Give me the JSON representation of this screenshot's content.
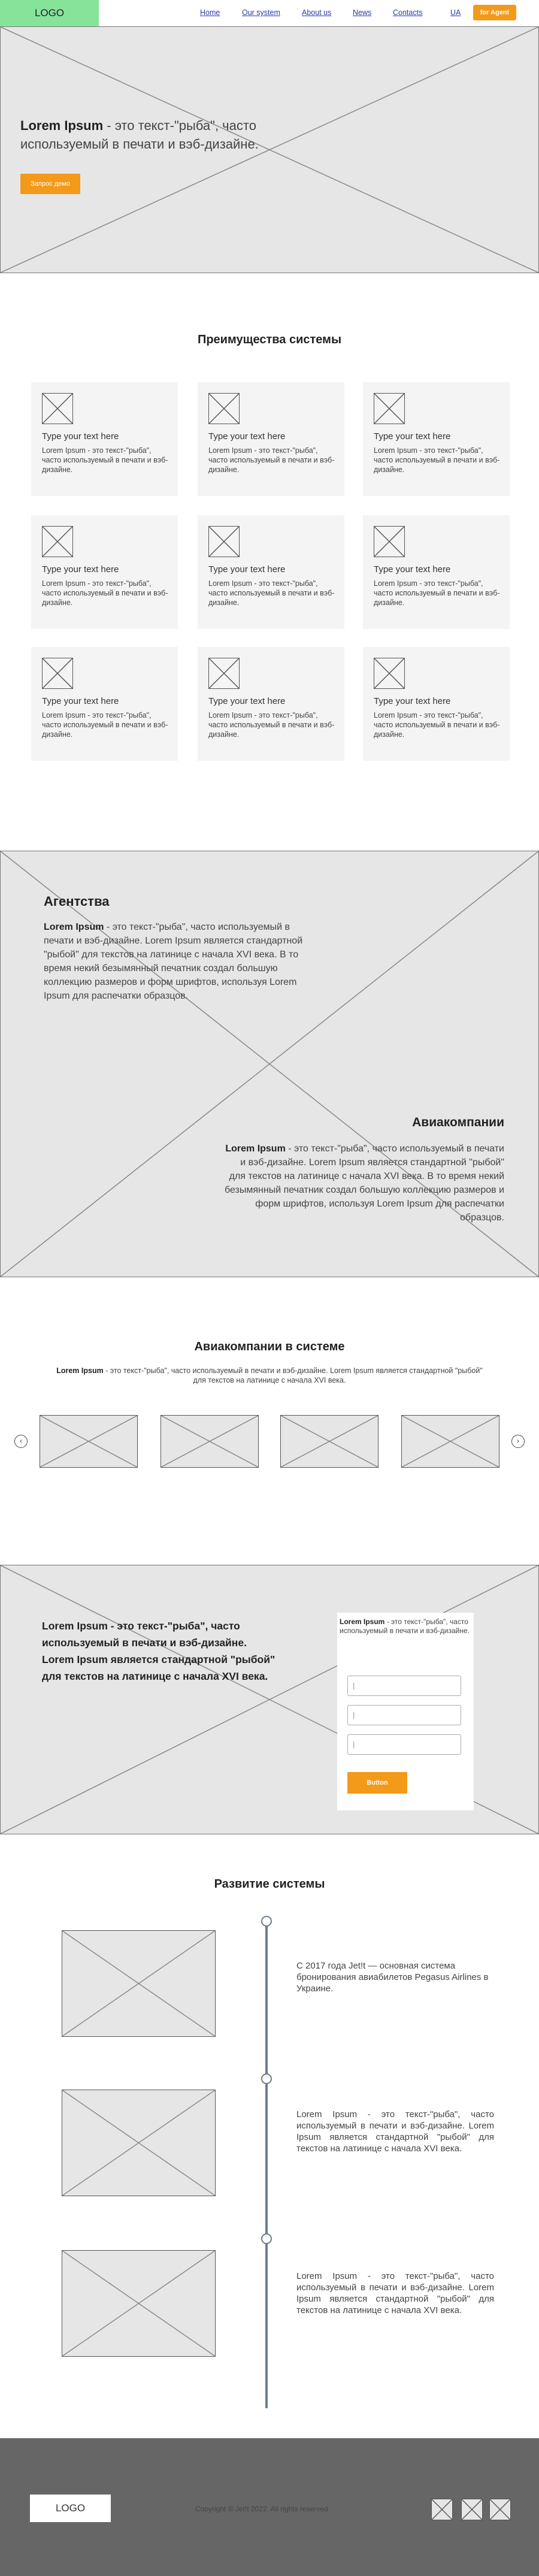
{
  "header": {
    "logo": "LOGO",
    "nav": [
      "Home",
      "Our system",
      "About us",
      "News",
      "Contacts"
    ],
    "lang": "UA",
    "cta": "for Agent"
  },
  "hero": {
    "lead_bold": "Lorem Ipsum",
    "lead_rest": " - это текст-\"рыба\", часто используемый в печати и вэб-дизайне.",
    "button": "Запрос демо"
  },
  "benefits": {
    "title": "Преимущества системы",
    "card_title": "Type your text here",
    "card_desc": "Lorem Ipsum - это текст-\"рыба\", часто используемый в печати и вэб-дизайне.",
    "count": 9
  },
  "agencies": {
    "title": "Агентства",
    "lead_bold": "Lorem Ipsum",
    "text": " - это текст-\"рыба\", часто используемый в печати и вэб-дизайне. Lorem Ipsum является стандартной \"рыбой\" для текстов на латинице с начала XVI века. В то время некий безымянный печатник создал большую коллекцию размеров и форм шрифтов, используя Lorem Ipsum для распечатки образцов."
  },
  "airlines_block": {
    "title": "Авиакомпании",
    "lead_bold": "Lorem Ipsum",
    "text": " - это текст-\"рыба\", часто используемый в печати и вэб-дизайне. Lorem Ipsum является стандартной \"рыбой\" для текстов на латинице с начала XVI века. В то время некий безымянный печатник создал большую коллекцию размеров и форм шрифтов, используя Lorem Ipsum для распечатки образцов."
  },
  "partners": {
    "title": "Авиакомпании в системе",
    "lead_bold": "Lorem Ipsum",
    "text": " - это текст-\"рыба\", часто используемый в печати и вэб-дизайне. Lorem Ipsum является стандартной \"рыбой\" для текстов на латинице с начала XVI века."
  },
  "contact": {
    "lead": "Lorem Ipsum - это текст-\"рыба\", часто используемый в печати и вэб-дизайне. Lorem Ipsum является стандартной \"рыбой\" для текстов на латинице с начала XVI века.",
    "form_lead_bold": "Lorem Ipsum",
    "form_lead": " - это текст-\"рыба\", часто используемый в печати и вэб-дизайне.",
    "input_placeholder": "|",
    "button": "Button"
  },
  "timeline": {
    "title": "Развитие системы",
    "items": [
      "С 2017 года Jet!t — основная система бронирования авиабилетов Pegasus Airlines в Украине.",
      "Lorem Ipsum - это текст-\"рыба\", часто используемый в печати и вэб-дизайне. Lorem Ipsum является стандартной \"рыбой\" для текстов на латинице с начала XVI века.",
      "Lorem Ipsum - это текст-\"рыба\", часто используемый в печати и вэб-дизайне. Lorem Ipsum является стандартной \"рыбой\" для текстов на латинице с начала XVI века."
    ]
  },
  "footer": {
    "logo": "LOGO",
    "copyright": "Copyright © Jet!t 2022. All rights reserved"
  }
}
